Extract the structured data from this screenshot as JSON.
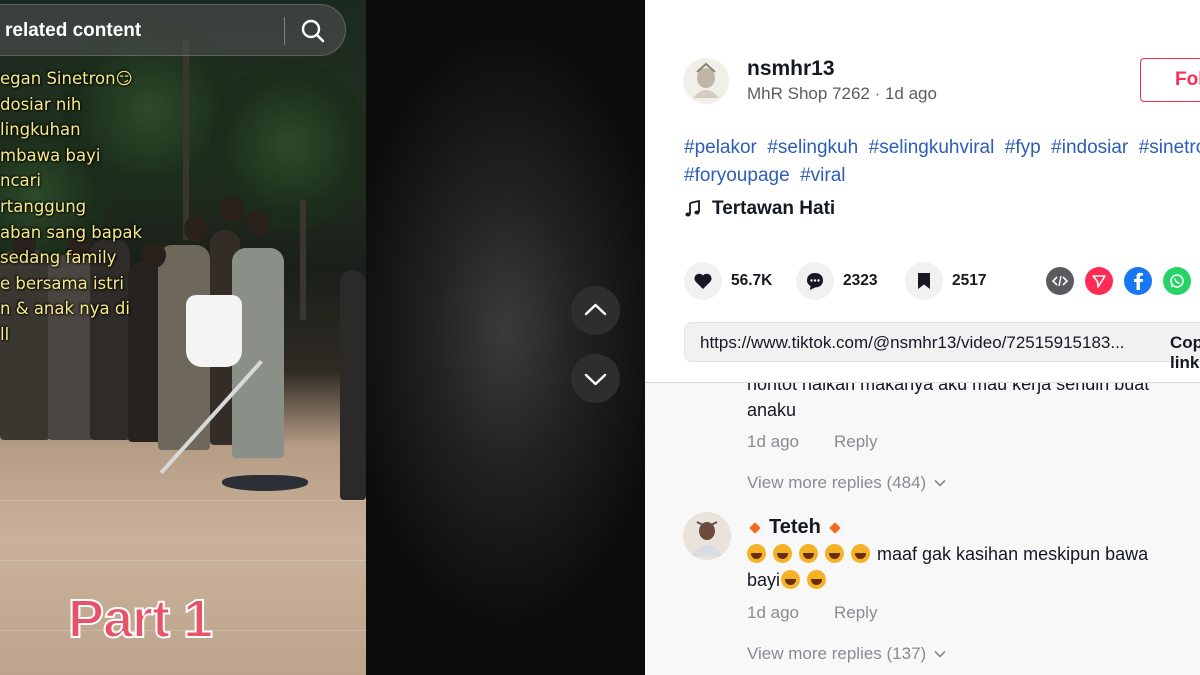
{
  "search": {
    "text": "related content"
  },
  "video": {
    "overlay_lines": [
      "egan Sinetron😏",
      "dosiar nih",
      "lingkuhan",
      "mbawa bayi",
      "ncari",
      "rtanggung",
      "aban sang bapak",
      " sedang family",
      "e bersama istri",
      "n & anak nya di",
      "ll"
    ],
    "part_label": "Part 1"
  },
  "author": {
    "username": "nsmhr13",
    "subline": "MhR Shop 7262 · 1d ago",
    "follow_label": "Follow"
  },
  "hashtags": [
    "#pelakor",
    "#selingkuh",
    "#selingkuhviral",
    "#fyp",
    "#indosiar",
    "#sinetron",
    "#foryoupage",
    "#viral"
  ],
  "music": {
    "title": "Tertawan Hati",
    "icon": "music-note-icon"
  },
  "actions": {
    "likes": "56.7K",
    "comments": "2323",
    "saves": "2517"
  },
  "share_icons": [
    "embed-icon",
    "send-icon",
    "facebook-icon",
    "whatsapp-icon"
  ],
  "link": {
    "url": "https://www.tiktok.com/@nsmhr13/video/72515915183...",
    "copy_label": "Copy link"
  },
  "comments": {
    "c1": {
      "text_line1": "nontot naikan makanya aku mau kerja sendiri buat",
      "text_line2": "anaku",
      "time": "1d ago",
      "reply_label": "Reply",
      "more_replies": "View more replies (484)"
    },
    "c2": {
      "name": "Teteh",
      "text_line1": "maaf gak kasihan meskipun bawa",
      "text_line2": "bayi",
      "time": "1d ago",
      "reply_label": "Reply",
      "more_replies": "View more replies (137)"
    }
  },
  "colors": {
    "accent": "#fe2c55",
    "hashtag": "#2b5db9",
    "overlay_text": "#f7e98a"
  }
}
